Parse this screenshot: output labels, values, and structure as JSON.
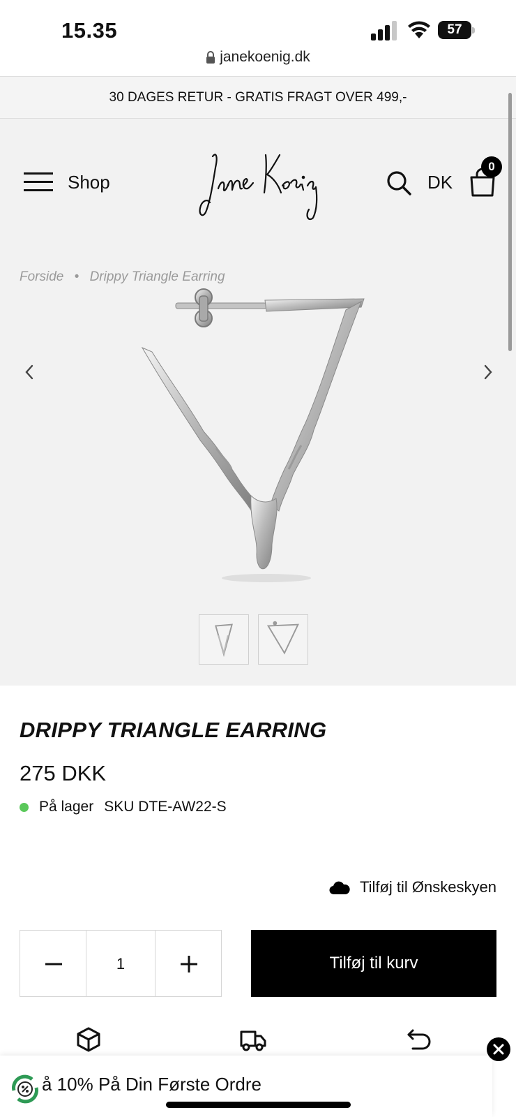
{
  "status_bar": {
    "time": "15.35",
    "battery": "57"
  },
  "browser": {
    "url": "janekoenig.dk"
  },
  "promo": {
    "text": "30 DAGES RETUR - GRATIS FRAGT OVER 499,-"
  },
  "header": {
    "shop_label": "Shop",
    "logo_text": "Jane Kœnig",
    "language": "DK",
    "cart_count": "0"
  },
  "breadcrumb": {
    "home": "Forside",
    "separator": "•",
    "current": "Drippy Triangle Earring"
  },
  "product": {
    "title": "DRIPPY TRIANGLE EARRING",
    "price": "275 DKK",
    "stock": "På lager",
    "sku": "SKU DTE-AW22-S",
    "wishlist_label": "Tilføj til Ønskeskyen",
    "quantity": "1",
    "add_to_cart_label": "Tilføj til kurv"
  },
  "popup": {
    "text": "å 10% På Din Første Ordre"
  },
  "colors": {
    "header_bg": "#f2f2f2",
    "button_bg": "#000000",
    "stock_dot": "#5ac85a",
    "breadcrumb": "#9a9a9a"
  }
}
